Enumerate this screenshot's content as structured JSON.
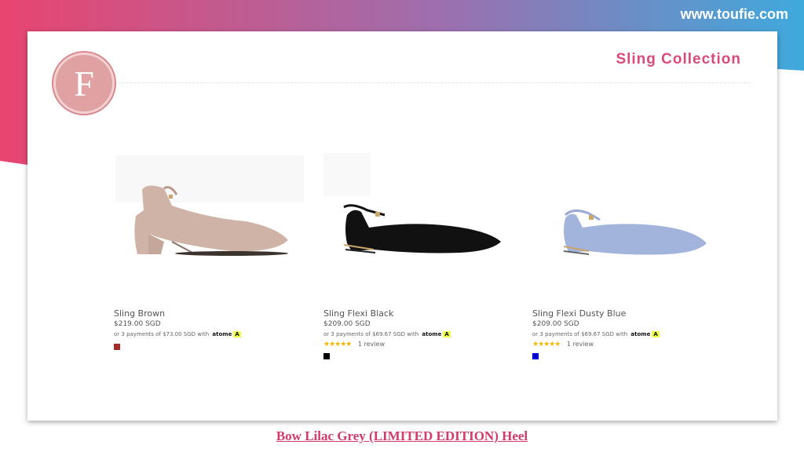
{
  "header": {
    "site_url": "www.toufie.com"
  },
  "slide": {
    "logo_letter": "F",
    "section_title": "Sling Collection"
  },
  "colors": {
    "accent_pink": "#d9497a",
    "gradient_start": "#e8456f",
    "gradient_end": "#3fa9dc",
    "logo_bg": "#e0a1a3"
  },
  "products": [
    {
      "name": "Sling Brown",
      "price": "$219.00 SGD",
      "installment_text": "or 3 payments of $73.00 SGD with",
      "atome_brand": "atome",
      "atome_badge": "A",
      "rating_text": "",
      "swatch_color": "#a52a2a",
      "image": "beige-slingback-block-heel-icon"
    },
    {
      "name": "Sling Flexi Black",
      "price": "$209.00 SGD",
      "installment_text": "or 3 payments of $69.67 SGD with",
      "atome_brand": "atome",
      "atome_badge": "A",
      "stars": "★★★★★",
      "rating_text": "1 review",
      "swatch_color": "#000000",
      "image": "black-slingback-flat-icon"
    },
    {
      "name": "Sling Flexi Dusty Blue",
      "price": "$209.00 SGD",
      "installment_text": "or 3 payments of $69.67 SGD with",
      "atome_brand": "atome",
      "atome_badge": "A",
      "stars": "★★★★★",
      "rating_text": "1 review",
      "swatch_color": "#0000cc",
      "image": "blue-slingback-flat-icon"
    }
  ],
  "footer": {
    "caption_link": "Bow Lilac Grey (LIMITED EDITION) Heel"
  }
}
